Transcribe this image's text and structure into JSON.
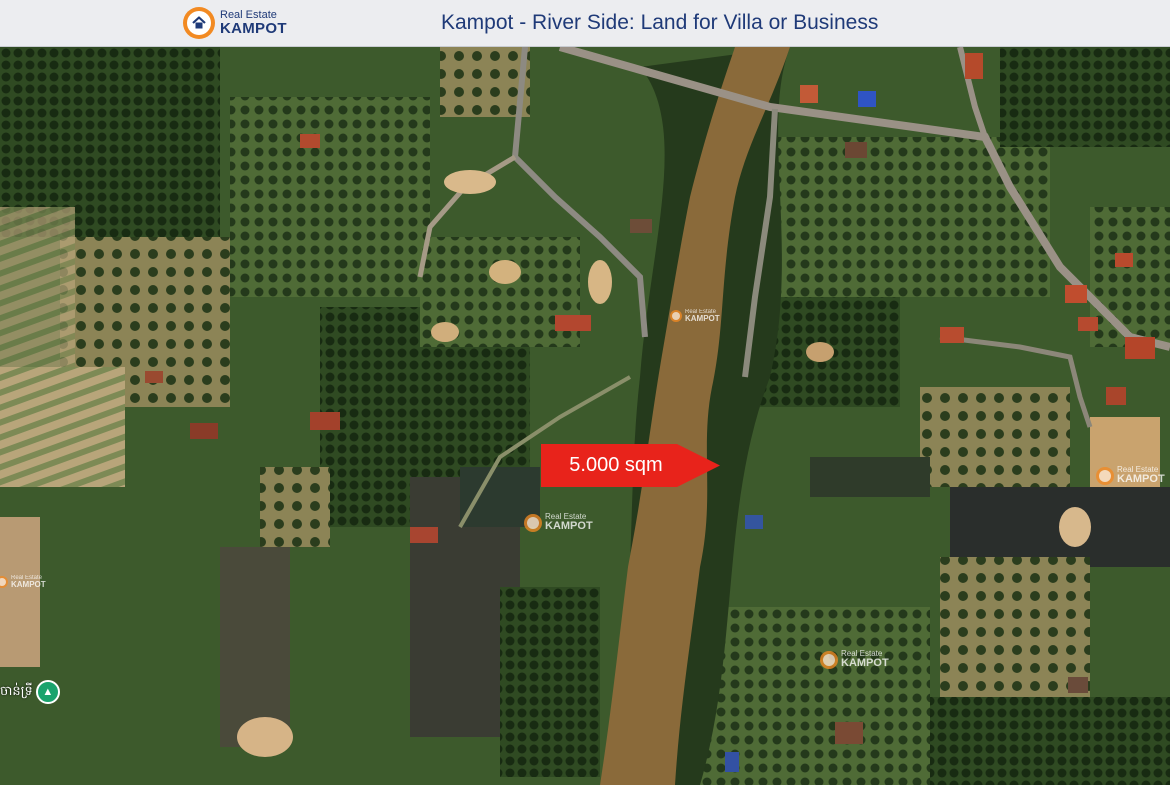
{
  "header": {
    "logo_small": "Real Estate",
    "logo_big": "KAMPOT",
    "title": "Kampot - River Side:  Land for Villa or Business"
  },
  "map": {
    "plot_label": "5.000 sqm",
    "place_label": "ចាន់ទ្រី",
    "place_icon": "park-icon",
    "colors": {
      "river": "#8a6a3a",
      "arrow": "#e8231b",
      "road": "#9a9186",
      "vegetation": "#3d5a2c"
    }
  },
  "watermarks": [
    {
      "small": "Real Estate",
      "big": "KAMPOT"
    },
    {
      "small": "Real Estate",
      "big": "KAMPOT"
    },
    {
      "small": "Real Estate",
      "big": "KAMPOT"
    },
    {
      "small": "Real Estate",
      "big": "KAMPOT"
    },
    {
      "small": "Real Estate",
      "big": "KAMPOT"
    }
  ]
}
